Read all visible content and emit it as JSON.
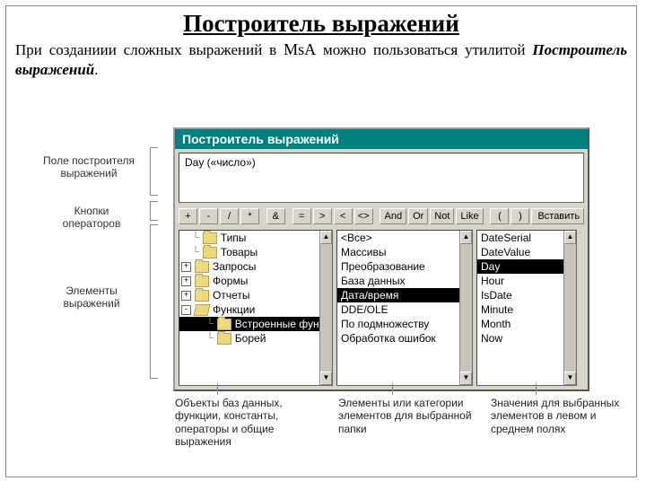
{
  "title": "Построитель выражений",
  "intro_part1": "При созданиии сложных выражений в ",
  "intro_msa": "MsA",
  "intro_part2": " можно пользоваться утилитой ",
  "intro_em": "Построитель выражений",
  "intro_end": ".",
  "labels": {
    "field": "Поле построителя выражений",
    "ops": "Кнопки операторов",
    "elements": "Элементы выражений"
  },
  "builder": {
    "titlebar": "Построитель выражений",
    "expr": "Day («число»)",
    "operators": [
      "+",
      "-",
      "/",
      "*",
      "&",
      "=",
      ">",
      "<",
      "<>",
      "And",
      "Or",
      "Not",
      "Like",
      "(",
      ")"
    ],
    "insert": "Вставить",
    "tree": [
      {
        "label": "Типы",
        "icon": "folder",
        "indent": 1,
        "expander": ""
      },
      {
        "label": "Товары",
        "icon": "folder",
        "indent": 1,
        "expander": ""
      },
      {
        "label": "Запросы",
        "icon": "folder",
        "indent": 0,
        "expander": "+"
      },
      {
        "label": "Формы",
        "icon": "folder",
        "indent": 0,
        "expander": "+"
      },
      {
        "label": "Отчеты",
        "icon": "folder",
        "indent": 0,
        "expander": "+"
      },
      {
        "label": "Функции",
        "icon": "folder-open",
        "indent": 0,
        "expander": "-"
      },
      {
        "label": "Встроенные функ",
        "icon": "folder",
        "indent": 2,
        "selected": true
      },
      {
        "label": "Борей",
        "icon": "folder",
        "indent": 2,
        "expander": ""
      }
    ],
    "middle": [
      "<Все>",
      "Массивы",
      "Преобразование",
      "База данных",
      "Дата/время",
      "DDE/OLE",
      "По подмножеству",
      "Обработка ошибок"
    ],
    "middle_selected": 4,
    "right": [
      "DateSerial",
      "DateValue",
      "Day",
      "Hour",
      "IsDate",
      "Minute",
      "Month",
      "Now"
    ],
    "right_selected": 2
  },
  "callouts": {
    "c1": "Объекты баз данных, функции, константы, операторы и общие выражения",
    "c2": "Элементы или категории элементов для выбранной папки",
    "c3": "Значения для выбранных элементов в левом и среднем полях"
  }
}
